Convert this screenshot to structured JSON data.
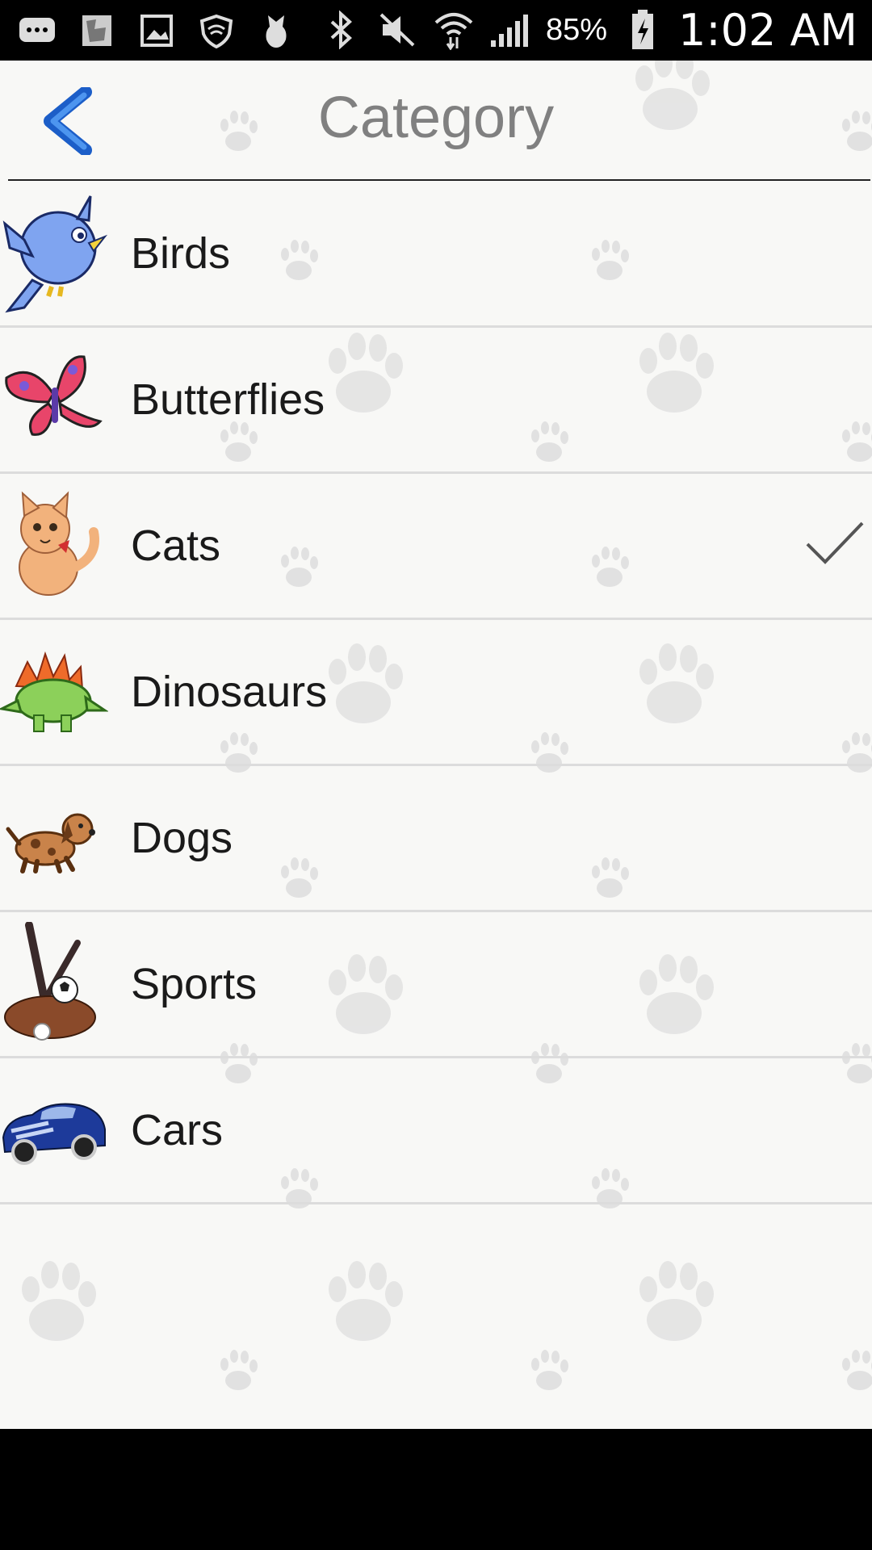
{
  "status_bar": {
    "battery": "85%",
    "time": "1:02 AM",
    "icons": [
      "messages-icon",
      "image-icon",
      "gallery-icon",
      "vpn-icon",
      "notification-icon",
      "bluetooth-icon",
      "mute-icon",
      "wifi-icon",
      "signal-icon",
      "battery-icon"
    ]
  },
  "header": {
    "title": "Category",
    "back_icon": "chevron-left-icon"
  },
  "categories": [
    {
      "label": "Birds",
      "icon": "bird-icon",
      "selected": false
    },
    {
      "label": "Butterflies",
      "icon": "butterfly-icon",
      "selected": false
    },
    {
      "label": "Cats",
      "icon": "cat-icon",
      "selected": true
    },
    {
      "label": "Dinosaurs",
      "icon": "dinosaur-icon",
      "selected": false
    },
    {
      "label": "Dogs",
      "icon": "dog-icon",
      "selected": false
    },
    {
      "label": "Sports",
      "icon": "sports-icon",
      "selected": false
    },
    {
      "label": "Cars",
      "icon": "car-icon",
      "selected": false
    }
  ],
  "colors": {
    "accent": "#2f6fd6",
    "title": "#808080",
    "background": "#f8f8f6"
  }
}
